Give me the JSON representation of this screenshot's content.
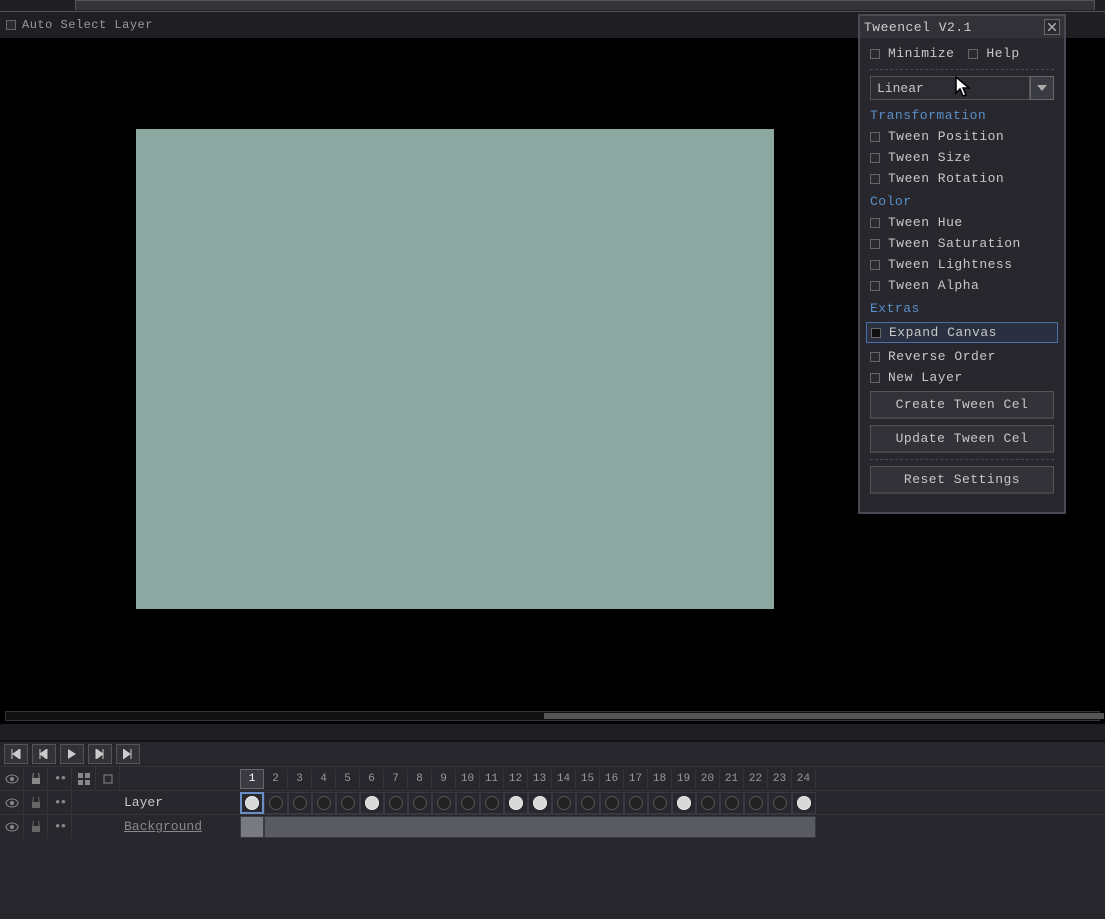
{
  "optionBar": {
    "autoSelectLayer": "Auto Select Layer"
  },
  "dialog": {
    "title": "Tweencel V2.1",
    "minimize": "Minimize",
    "help": "Help",
    "easing": "Linear",
    "sections": {
      "transformation": "Transformation",
      "color": "Color",
      "extras": "Extras"
    },
    "options": {
      "tweenPosition": "Tween Position",
      "tweenSize": "Tween Size",
      "tweenRotation": "Tween Rotation",
      "tweenHue": "Tween Hue",
      "tweenSaturation": "Tween Saturation",
      "tweenLightness": "Tween Lightness",
      "tweenAlpha": "Tween Alpha",
      "expandCanvas": "Expand Canvas",
      "reverseOrder": "Reverse Order",
      "newLayer": "New Layer"
    },
    "buttons": {
      "create": "Create Tween Cel",
      "update": "Update Tween Cel",
      "reset": "Reset Settings"
    }
  },
  "timeline": {
    "layers": {
      "layer1": "Layer",
      "background": "Background"
    },
    "frameNumbers": [
      "1",
      "2",
      "3",
      "4",
      "5",
      "6",
      "7",
      "8",
      "9",
      "10",
      "11",
      "12",
      "13",
      "14",
      "15",
      "16",
      "17",
      "18",
      "19",
      "20",
      "21",
      "22",
      "23",
      "24"
    ],
    "cels": [
      {
        "filled": true
      },
      {
        "filled": false
      },
      {
        "filled": false
      },
      {
        "filled": false
      },
      {
        "filled": false
      },
      {
        "filled": true
      },
      {
        "filled": false
      },
      {
        "filled": false
      },
      {
        "filled": false
      },
      {
        "filled": false
      },
      {
        "filled": false
      },
      {
        "filled": true
      },
      {
        "filled": true
      },
      {
        "filled": false
      },
      {
        "filled": false
      },
      {
        "filled": false
      },
      {
        "filled": false
      },
      {
        "filled": false
      },
      {
        "filled": true
      },
      {
        "filled": false
      },
      {
        "filled": false
      },
      {
        "filled": false
      },
      {
        "filled": false
      },
      {
        "filled": true
      }
    ]
  }
}
